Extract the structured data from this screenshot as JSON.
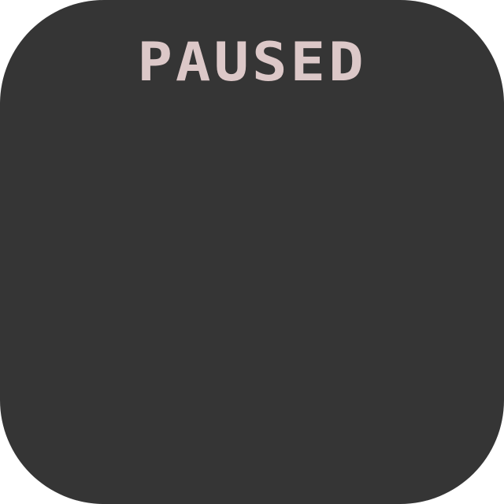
{
  "pause_screen": {
    "title": "PAUSED"
  },
  "colors": {
    "panel_background": "#353535",
    "title_text": "#dcc8c8",
    "page_background": "#ffffff"
  }
}
